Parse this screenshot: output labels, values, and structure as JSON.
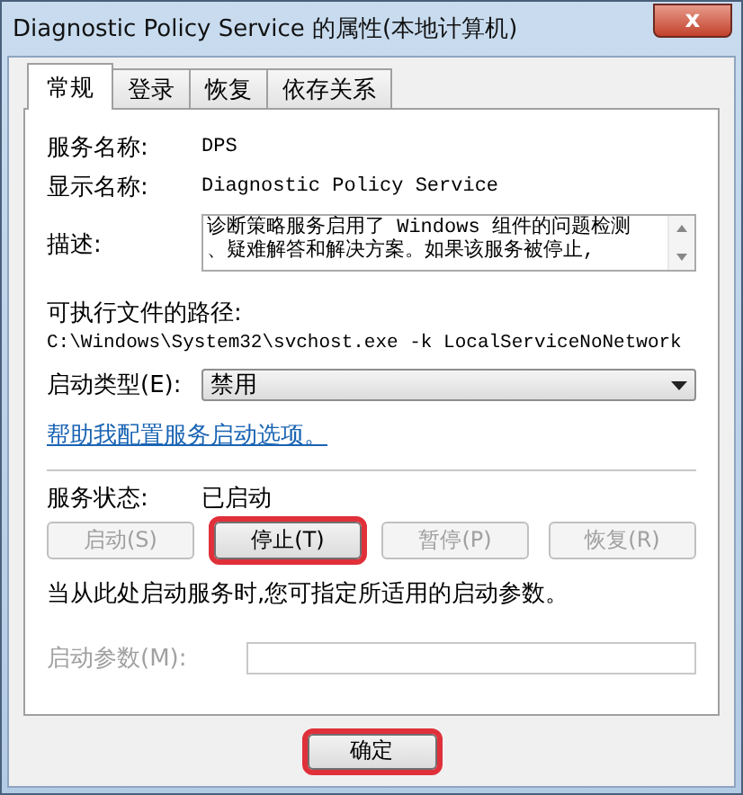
{
  "window": {
    "title": "Diagnostic Policy Service 的属性(本地计算机)",
    "close": "x"
  },
  "tabs": [
    {
      "label": "常规",
      "selected": true
    },
    {
      "label": "登录",
      "selected": false
    },
    {
      "label": "恢复",
      "selected": false
    },
    {
      "label": "依存关系",
      "selected": false
    }
  ],
  "fields": [
    {
      "label": "服务名称:",
      "value": "DPS"
    },
    {
      "label": "显示名称:",
      "value": "Diagnostic Policy Service"
    }
  ],
  "description": {
    "label": "描述:",
    "lines": [
      "诊断策略服务启用了 Windows 组件的问题检测",
      "、疑难解答和解决方案。如果该服务被停止,"
    ]
  },
  "path": {
    "label": "可执行文件的路径:",
    "value": "C:\\Windows\\System32\\svchost.exe -k LocalServiceNoNetwork"
  },
  "startup_type": {
    "label": "启动类型(E):",
    "value": "禁用"
  },
  "help_link": "帮助我配置服务启动选项。",
  "status": {
    "label": "服务状态:",
    "value": "已启动"
  },
  "service_buttons": [
    {
      "label": "启动(S)",
      "disabled": true,
      "highlighted": false
    },
    {
      "label": "停止(T)",
      "disabled": false,
      "highlighted": true
    },
    {
      "label": "暂停(P)",
      "disabled": true,
      "highlighted": false
    },
    {
      "label": "恢复(R)",
      "disabled": true,
      "highlighted": false
    }
  ],
  "hint": "当从此处启动服务时,您可指定所适用的启动参数。",
  "parameters": {
    "label": "启动参数(M):",
    "disabled": true
  },
  "footer_buttons": [
    {
      "label": "确定",
      "disabled": false,
      "highlighted": true
    }
  ]
}
